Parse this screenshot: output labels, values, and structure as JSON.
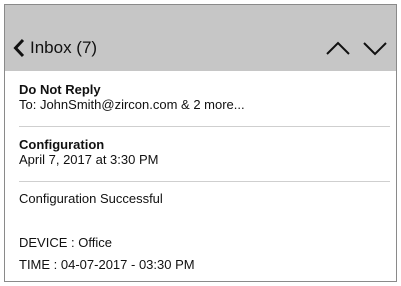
{
  "header": {
    "title": "Inbox (7)",
    "icons": {
      "back": "chevron-left-icon",
      "up": "chevron-up-icon",
      "down": "chevron-down-icon"
    },
    "background": "#c6c6c6"
  },
  "message": {
    "sender": "Do Not Reply",
    "recipients": "To: JohnSmith@zircon.com & 2 more...",
    "subject": "Configuration",
    "date": "April 7, 2017 at 3:30 PM",
    "body": [
      "Configuration Successful",
      "DEVICE : Office",
      "TIME : 04-07-2017 - 03:30 PM"
    ]
  }
}
